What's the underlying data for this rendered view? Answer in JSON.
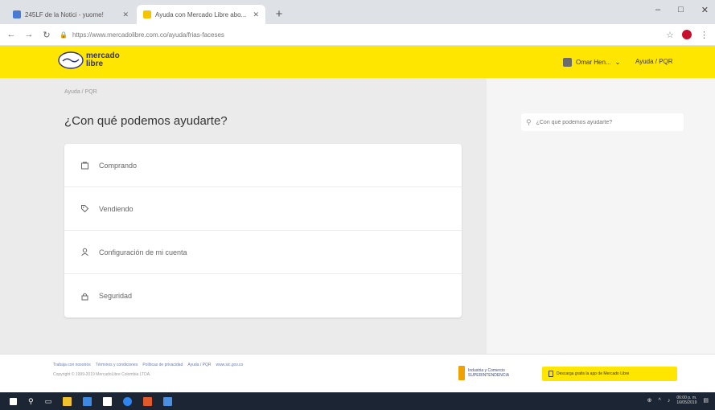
{
  "browser": {
    "tabs": [
      {
        "title": "245LF de la Notici - yuome!",
        "active": false,
        "favicon_color": "#4a7bd4"
      },
      {
        "title": "Ayuda con Mercado Libre abo...",
        "active": true,
        "favicon_color": "#f5c400"
      }
    ],
    "url": "https://www.mercadolibre.com.co/ayuda/frias-faceses",
    "new_tab": "+",
    "window_controls": [
      "–",
      "□",
      "✕"
    ]
  },
  "header": {
    "logo_line1": "mercado",
    "logo_line2": "libre",
    "user_label": "Omar Hen...",
    "help_link": "Ayuda / PQR"
  },
  "main": {
    "breadcrumb": "Ayuda / PQR",
    "title": "¿Con qué podemos ayudarte?",
    "items": [
      {
        "label": "Comprando",
        "icon": "bag-icon"
      },
      {
        "label": "Vendiendo",
        "icon": "tag-icon"
      },
      {
        "label": "Configuración de mi cuenta",
        "icon": "user-icon"
      },
      {
        "label": "Seguridad",
        "icon": "lock-icon"
      }
    ]
  },
  "search": {
    "placeholder": "¿Con qué podemos ayudarte?"
  },
  "footer": {
    "links": [
      "Trabaja con nosotros",
      "Términos y condiciones",
      "Políticas de privacidad",
      "Ayuda / PQR",
      "www.sic.gov.co"
    ],
    "copyright": "Copyright © 1999-2019 MercadoLibre Colombia LTDA.",
    "sic_line1": "Industria y Comercio",
    "sic_line2": "SUPERINTENDENCIA",
    "app_button": "Descarga gratis la app de Mercado Libre"
  },
  "taskbar": {
    "time": "06:00 p. m.",
    "date": "16/05/2019"
  },
  "colors": {
    "brand_yellow": "#ffe600",
    "brand_blue": "#2d3277",
    "taskbar": "#1c2533"
  }
}
